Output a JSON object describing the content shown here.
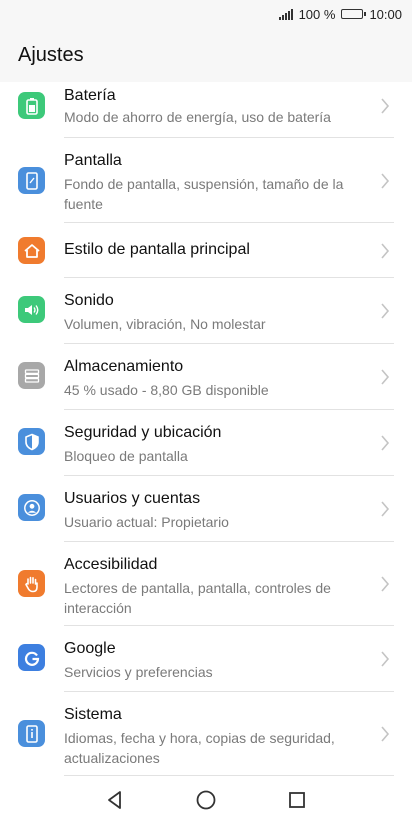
{
  "status_bar": {
    "battery_text": "100 %",
    "time": "10:00"
  },
  "header": {
    "title": "Ajustes"
  },
  "items": [
    {
      "title": "Batería",
      "subtitle": "Modo de ahorro de energía, uso de batería",
      "icon": "battery-icon",
      "color": "#3dc97a"
    },
    {
      "title": "Pantalla",
      "subtitle": "Fondo de pantalla, suspensión, tamaño de la fuente",
      "icon": "display-icon",
      "color": "#4a8fdc"
    },
    {
      "title": "Estilo de pantalla principal",
      "subtitle": "",
      "icon": "home-icon",
      "color": "#f07b2e"
    },
    {
      "title": "Sonido",
      "subtitle": "Volumen, vibración, No molestar",
      "icon": "speaker-icon",
      "color": "#3dc97a"
    },
    {
      "title": "Almacenamiento",
      "subtitle": "45 % usado - 8,80 GB disponible",
      "icon": "storage-icon",
      "color": "#a8a8a8"
    },
    {
      "title": "Seguridad y ubicación",
      "subtitle": "Bloqueo de pantalla",
      "icon": "shield-icon",
      "color": "#4a8fdc"
    },
    {
      "title": "Usuarios y cuentas",
      "subtitle": "Usuario actual: Propietario",
      "icon": "user-icon",
      "color": "#4a8fdc"
    },
    {
      "title": "Accesibilidad",
      "subtitle": "Lectores de pantalla, pantalla, controles de interacción",
      "icon": "hand-icon",
      "color": "#f07b2e"
    },
    {
      "title": "Google",
      "subtitle": "Servicios y preferencias",
      "icon": "google-icon",
      "color": "#3d7fe0"
    },
    {
      "title": "Sistema",
      "subtitle": "Idiomas, fecha y hora, copias de seguridad, actualizaciones",
      "icon": "system-info-icon",
      "color": "#4a8fdc"
    }
  ]
}
